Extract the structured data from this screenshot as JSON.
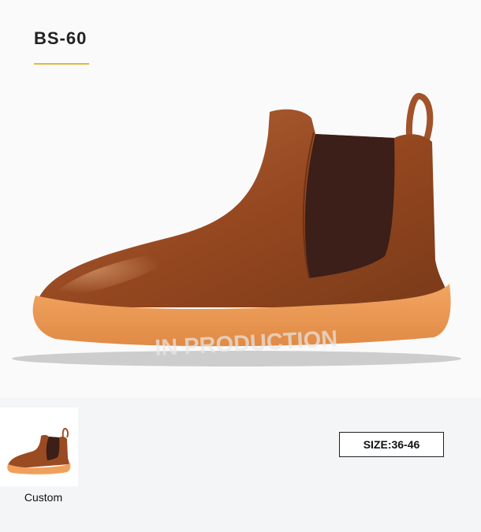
{
  "product": {
    "model": "BS-60",
    "watermark": "IN PRODUCTION",
    "accent_color": "#e3b73a"
  },
  "thumbnails": [
    {
      "label": "Custom"
    }
  ],
  "size": {
    "label": "SIZE:36-46"
  }
}
